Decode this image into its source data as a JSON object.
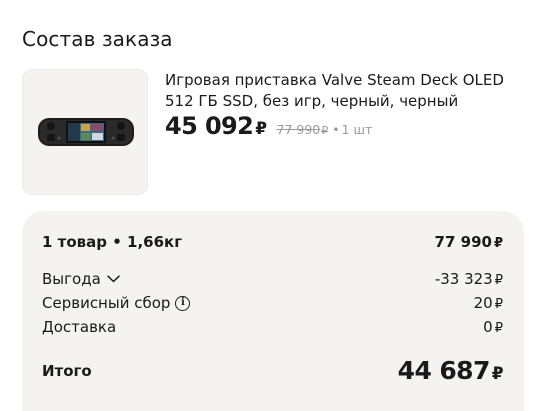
{
  "order": {
    "title": "Состав заказа",
    "item": {
      "image_icon": "steam-deck-console",
      "name": "Игровая приставка Valve Steam Deck OLED 512 ГБ SSD, без игр, черный, черный",
      "price": "45 092",
      "old_price": "77 990",
      "currency": "₽",
      "quantity": "1 шт"
    }
  },
  "summary": {
    "goods_label": "1 товар • 1,66кг",
    "goods_value": "77 990",
    "discount_label": "Выгода",
    "discount_value": "-33 323",
    "service_fee_label": "Сервисный сбор",
    "service_fee_value": "20",
    "delivery_label": "Доставка",
    "delivery_value": "0",
    "total_label": "Итого",
    "total_value": "44 687",
    "currency": "₽"
  },
  "colors": {
    "panel_bg": "#f4f3f1",
    "text": "#1a1a1a",
    "muted": "#9a9a9a"
  }
}
